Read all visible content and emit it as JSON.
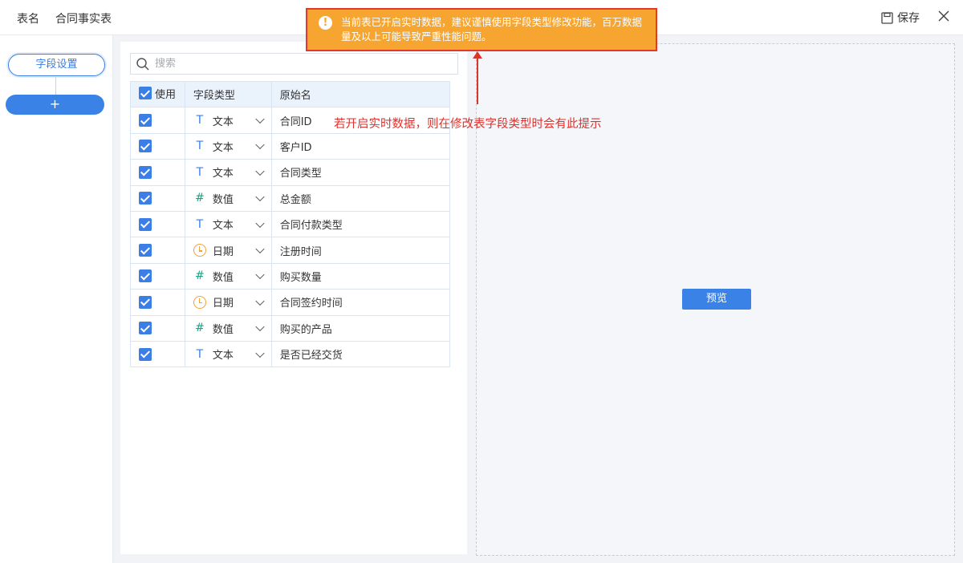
{
  "topbar": {
    "table_name_label": "表名",
    "table_name_value": "合同事实表",
    "save_label": "保存"
  },
  "warning": {
    "text": "当前表已开启实时数据，建议谨慎使用字段类型修改功能，百万数据量及以上可能导致严重性能问题。"
  },
  "sidebar": {
    "step_label": "字段设置",
    "add_label": "+"
  },
  "search": {
    "placeholder": "搜索",
    "value": ""
  },
  "table": {
    "headers": {
      "use": "使用",
      "type": "字段类型",
      "name": "原始名"
    },
    "rows": [
      {
        "checked": true,
        "type_icon": "text-icon",
        "type": "文本",
        "name": "合同ID"
      },
      {
        "checked": true,
        "type_icon": "text-icon",
        "type": "文本",
        "name": "客户ID"
      },
      {
        "checked": true,
        "type_icon": "text-icon",
        "type": "文本",
        "name": "合同类型"
      },
      {
        "checked": true,
        "type_icon": "number-icon",
        "type": "数值",
        "name": "总金额"
      },
      {
        "checked": true,
        "type_icon": "text-icon",
        "type": "文本",
        "name": "合同付款类型"
      },
      {
        "checked": true,
        "type_icon": "date-icon",
        "type": "日期",
        "name": "注册时间"
      },
      {
        "checked": true,
        "type_icon": "number-icon",
        "type": "数值",
        "name": "购买数量"
      },
      {
        "checked": true,
        "type_icon": "date-icon",
        "type": "日期",
        "name": "合同签约时间"
      },
      {
        "checked": true,
        "type_icon": "number-icon",
        "type": "数值",
        "name": "购买的产品"
      },
      {
        "checked": true,
        "type_icon": "text-icon",
        "type": "文本",
        "name": "是否已经交货"
      }
    ]
  },
  "preview": {
    "button_label": "预览"
  },
  "annotation": {
    "text": "若开启实时数据，则在修改表字段类型时会有此提示"
  },
  "colors": {
    "accent": "#3a7ee6",
    "warning_bg": "#f6a531",
    "annotation_red": "#e0302b"
  }
}
